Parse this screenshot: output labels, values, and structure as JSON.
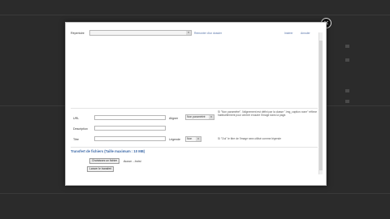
{
  "modal": {
    "directory_label": "Répertoire",
    "directory_value": "",
    "up_link": "Remonter d'un dossier",
    "insert_link": "Insérer",
    "cancel_link": "Annuler",
    "url_label": "URL",
    "description_label": "Description",
    "title_label": "Titre",
    "align_label": "Aligner",
    "align_value": "Non paramétré",
    "legend_label": "Légende",
    "legend_value": "Non",
    "align_note": "Si \"Non paramétré\", l'alignement est défini par la classe \".img_caption.none\" réflexe habituellement pour centrer enoutre l'image dans la page.",
    "legend_note": "Si \"Oui\" le titre de l'image sera utilisé comme légende",
    "upload_title": "Transfert de fichiers (Taille maximum : 10 MB)",
    "browse_button": "Choisissez un fichier",
    "no_file_text": "Aucun ...hoisi",
    "start_upload_button": "Lancer le transfert"
  },
  "close_icon": "close-icon"
}
